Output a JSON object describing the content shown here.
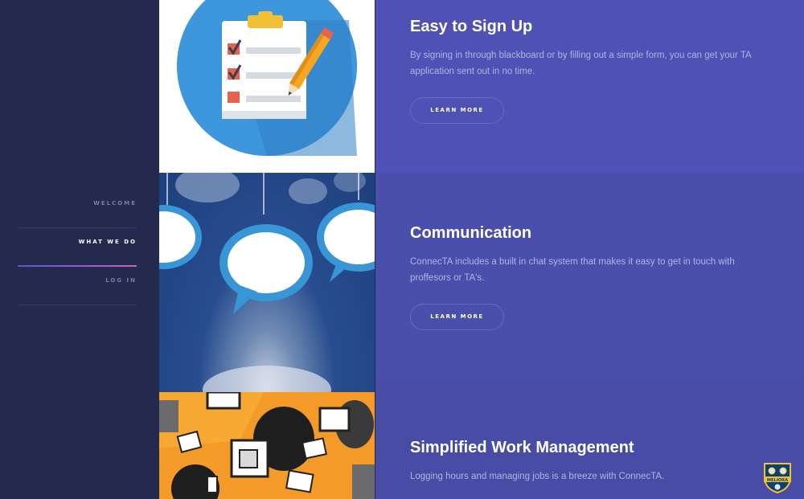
{
  "nav": {
    "items": [
      {
        "label": "WELCOME",
        "active": false
      },
      {
        "label": "WHAT WE DO",
        "active": true
      },
      {
        "label": "LOG IN",
        "active": false
      }
    ]
  },
  "features": [
    {
      "title": "Easy to Sign Up",
      "description": "By signing in through blackboard or by filling out a simple form, you can get your TA application sent out in no time.",
      "button_label": "LEARN MORE",
      "image_icon": "clipboard-checklist-icon"
    },
    {
      "title": "Communication",
      "description": "ConnecTA includes a built in chat system that makes it easy to get in touch with proffesors or TA's.",
      "button_label": "LEARN MORE",
      "image_icon": "hanging-speech-bubbles-image"
    },
    {
      "title": "Simplified Work Management",
      "description": "Logging hours and managing jobs is a breeze with ConnecTA.",
      "image_icon": "office-workers-illustration"
    }
  ],
  "badge": {
    "motto": "MELIORA",
    "icon": "university-crest-icon"
  },
  "colors": {
    "sidebar": "#232a4d",
    "panel": "#4f51b4",
    "accent_gradient": [
      "#5a56c8",
      "#d05fb8"
    ]
  }
}
